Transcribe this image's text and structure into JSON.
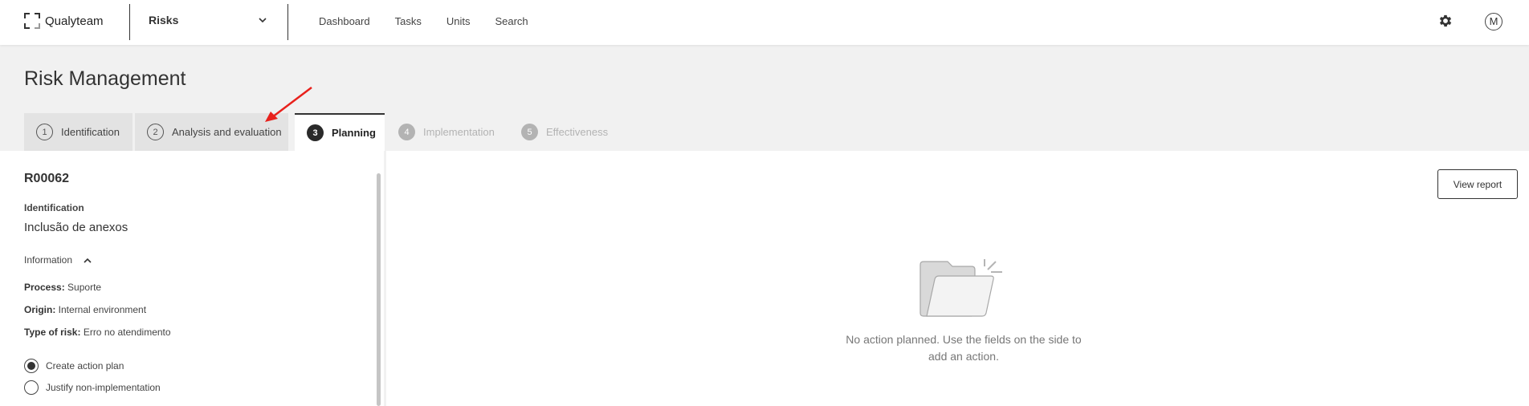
{
  "app": {
    "name": "Qualyteam"
  },
  "module_select": {
    "value": "Risks"
  },
  "nav": [
    {
      "label": "Dashboard"
    },
    {
      "label": "Tasks"
    },
    {
      "label": "Units"
    },
    {
      "label": "Search"
    }
  ],
  "header": {
    "settings_icon": "gear-icon",
    "avatar_initial": "M"
  },
  "page": {
    "title": "Risk Management"
  },
  "steps": [
    {
      "num": "1",
      "label": "Identification",
      "state": "done"
    },
    {
      "num": "2",
      "label": "Analysis and evaluation",
      "state": "done"
    },
    {
      "num": "3",
      "label": "Planning",
      "state": "active"
    },
    {
      "num": "4",
      "label": "Implementation",
      "state": "future"
    },
    {
      "num": "5",
      "label": "Effectiveness",
      "state": "future"
    }
  ],
  "risk": {
    "id": "R00062",
    "identification_label": "Identification",
    "identification_value": "Inclusão de anexos",
    "information_label": "Information",
    "process_label": "Process:",
    "process_value": "Suporte",
    "origin_label": "Origin:",
    "origin_value": "Internal environment",
    "type_label": "Type of risk:",
    "type_value": "Erro no atendimento"
  },
  "options": [
    {
      "label": "Create action plan",
      "selected": true
    },
    {
      "label": "Justify non-implementation",
      "selected": false
    }
  ],
  "actions": {
    "view_report": "View report",
    "empty_line1": "No action planned. Use the fields on the side to",
    "empty_line2": "add an action."
  },
  "colors": {
    "annotation_arrow": "#e8211c",
    "active_step": "#2a2a2a"
  }
}
